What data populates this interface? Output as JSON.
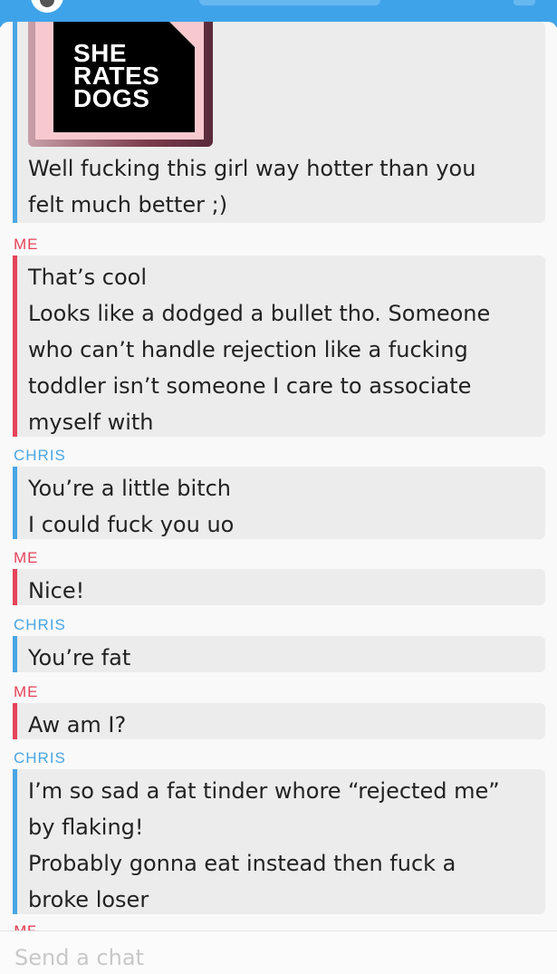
{
  "chat": {
    "image_logo": {
      "line1": "SHE",
      "line2": "RATES",
      "line3": "DOGS"
    },
    "messages": [
      {
        "sender": "",
        "lines": [
          "Well fucking this girl way hotter than you",
          "felt much better ;)"
        ]
      },
      {
        "sender": "ME",
        "lines": [
          "That’s cool",
          "Looks like a dodged a bullet tho. Someone",
          "who can’t handle rejection like a fucking",
          "toddler isn’t someone I care to associate",
          "myself with"
        ]
      },
      {
        "sender": "CHRIS",
        "lines": [
          "You’re a little bitch",
          "I could fuck you uo"
        ]
      },
      {
        "sender": "ME",
        "lines": [
          "Nice!"
        ]
      },
      {
        "sender": "CHRIS",
        "lines": [
          "You’re fat"
        ]
      },
      {
        "sender": "ME",
        "lines": [
          "Aw am I?"
        ]
      },
      {
        "sender": "CHRIS",
        "lines": [
          "I’m so sad a fat tinder whore “rejected me”",
          "by flaking!",
          "Probably gonna eat instead then fuck a",
          "broke loser"
        ]
      }
    ],
    "cut_off_sender": "ME"
  },
  "input": {
    "placeholder": "Send a chat"
  },
  "colors": {
    "me": "#e5435a",
    "other": "#4aa6e4",
    "header": "#3fa3ea"
  }
}
